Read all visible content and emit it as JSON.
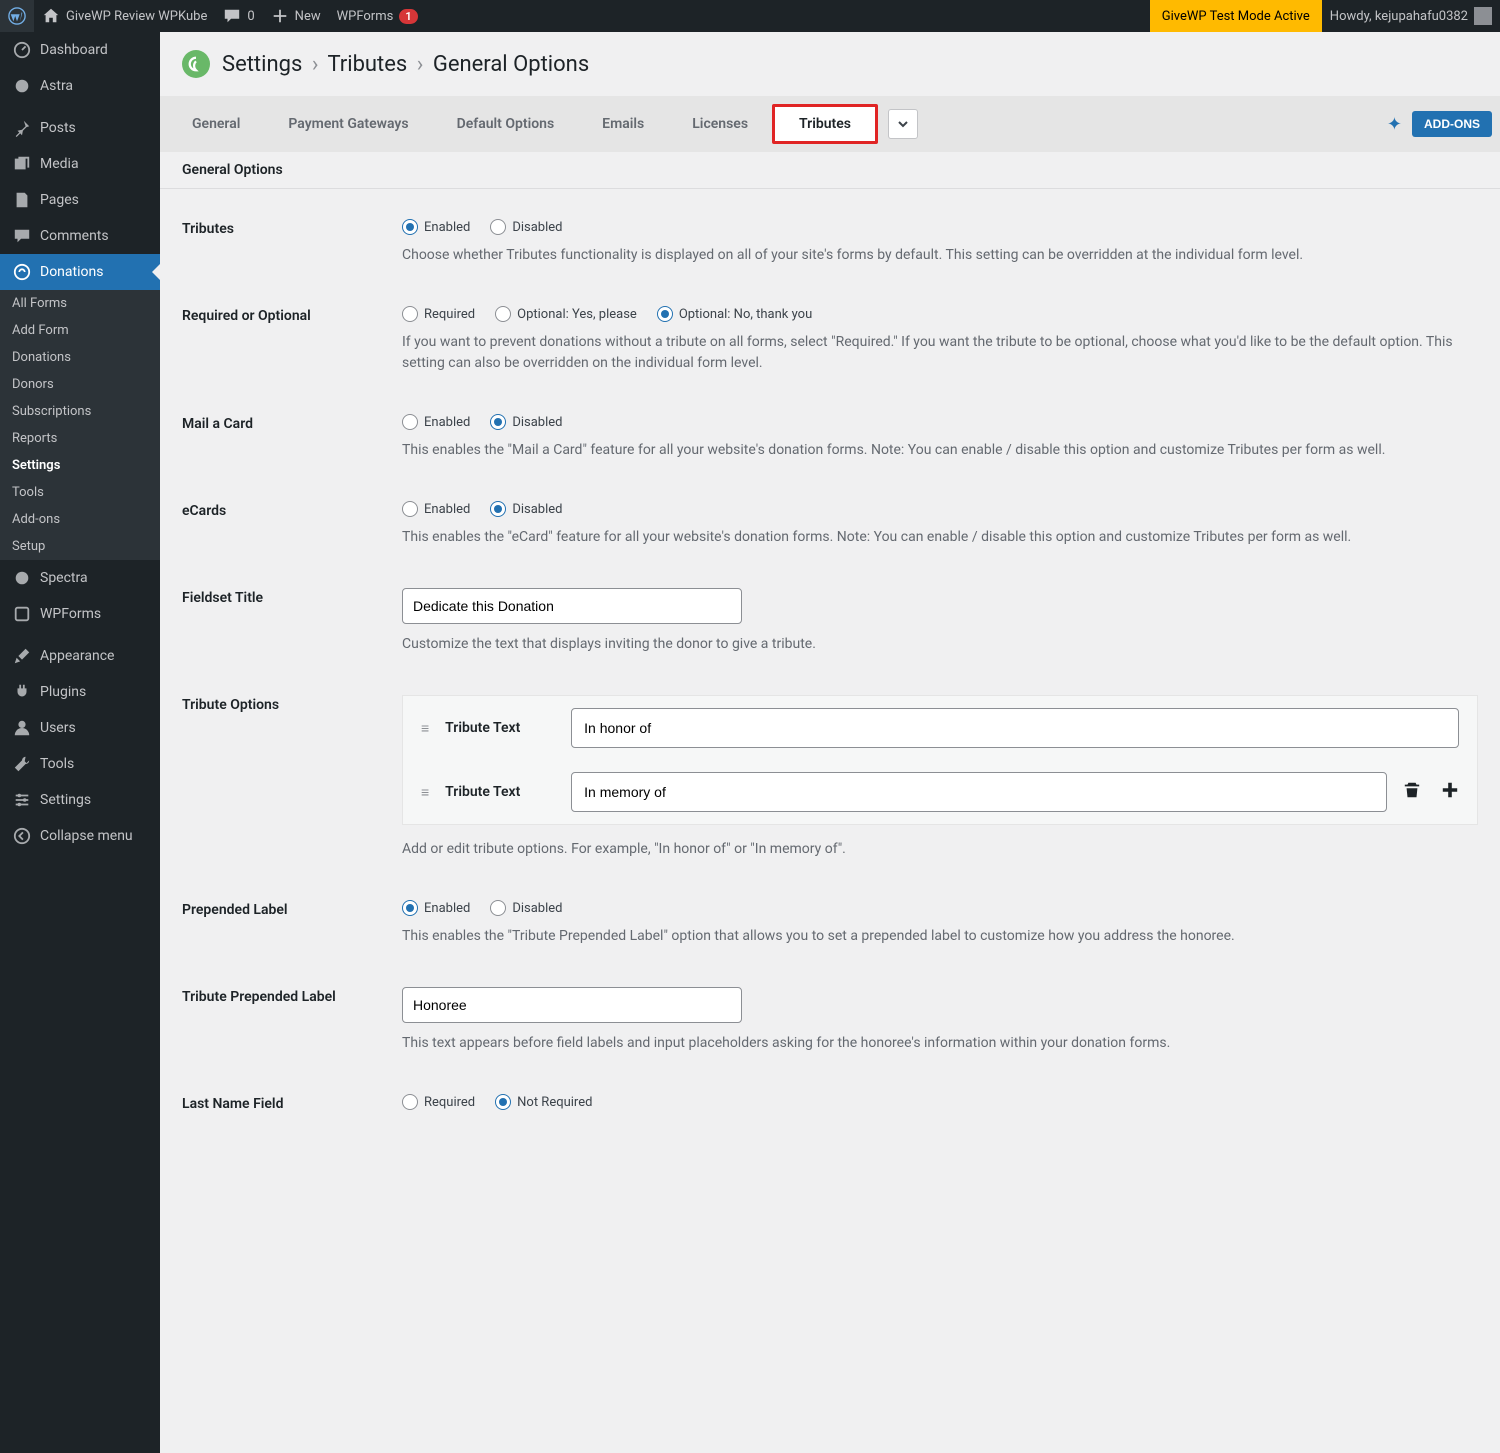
{
  "topbar": {
    "site_name": "GiveWP Review WPKube",
    "comments_count": "0",
    "new_label": "New",
    "wpforms_label": "WPForms",
    "wpforms_count": "1",
    "test_mode": "GiveWP Test Mode Active",
    "howdy": "Howdy, kejupahafu0382"
  },
  "sidebar": {
    "items": [
      {
        "label": "Dashboard"
      },
      {
        "label": "Astra"
      },
      {
        "label": "Posts"
      },
      {
        "label": "Media"
      },
      {
        "label": "Pages"
      },
      {
        "label": "Comments"
      },
      {
        "label": "Donations"
      },
      {
        "label": "Spectra"
      },
      {
        "label": "WPForms"
      },
      {
        "label": "Appearance"
      },
      {
        "label": "Plugins"
      },
      {
        "label": "Users"
      },
      {
        "label": "Tools"
      },
      {
        "label": "Settings"
      },
      {
        "label": "Collapse menu"
      }
    ],
    "submenu": [
      {
        "label": "All Forms"
      },
      {
        "label": "Add Form"
      },
      {
        "label": "Donations"
      },
      {
        "label": "Donors"
      },
      {
        "label": "Subscriptions"
      },
      {
        "label": "Reports"
      },
      {
        "label": "Settings"
      },
      {
        "label": "Tools"
      },
      {
        "label": "Add-ons"
      },
      {
        "label": "Setup"
      }
    ]
  },
  "header": {
    "crumb1": "Settings",
    "sep": "›",
    "crumb2": "Tributes",
    "crumb3": "General Options"
  },
  "tabs": [
    "General",
    "Payment Gateways",
    "Default Options",
    "Emails",
    "Licenses",
    "Tributes"
  ],
  "addons_label": "ADD-ONS",
  "subsection": "General Options",
  "common": {
    "enabled": "Enabled",
    "disabled": "Disabled",
    "required": "Required",
    "not_required": "Not Required"
  },
  "rows": {
    "tributes": {
      "label": "Tributes",
      "desc": "Choose whether Tributes functionality is displayed on all of your site's forms by default. This setting can be overridden at the individual form level."
    },
    "required": {
      "label": "Required or Optional",
      "opt1": "Required",
      "opt2": "Optional: Yes, please",
      "opt3": "Optional: No, thank you",
      "desc": "If you want to prevent donations without a tribute on all forms, select \"Required.\" If you want the tribute to be optional, choose what you'd like to be the default option. This setting can also be overridden on the individual form level."
    },
    "mail": {
      "label": "Mail a Card",
      "desc": "This enables the \"Mail a Card\" feature for all your website's donation forms. Note: You can enable / disable this option and customize Tributes per form as well."
    },
    "ecards": {
      "label": "eCards",
      "desc": "This enables the \"eCard\" feature for all your website's donation forms. Note: You can enable / disable this option and customize Tributes per form as well."
    },
    "fieldset": {
      "label": "Fieldset Title",
      "value": "Dedicate this Donation",
      "desc": "Customize the text that displays inviting the donor to give a tribute."
    },
    "options": {
      "label": "Tribute Options",
      "text_label": "Tribute Text",
      "opt1": "In honor of",
      "opt2": "In memory of",
      "desc": "Add or edit tribute options. For example, \"In honor of\" or \"In memory of\"."
    },
    "prepended": {
      "label": "Prepended Label",
      "desc": "This enables the \"Tribute Prepended Label\" option that allows you to set a prepended label to customize how you address the honoree."
    },
    "prepended_label": {
      "label": "Tribute Prepended Label",
      "value": "Honoree",
      "desc": "This text appears before field labels and input placeholders asking for the honoree's information within your donation forms."
    },
    "last_name": {
      "label": "Last Name Field"
    }
  }
}
